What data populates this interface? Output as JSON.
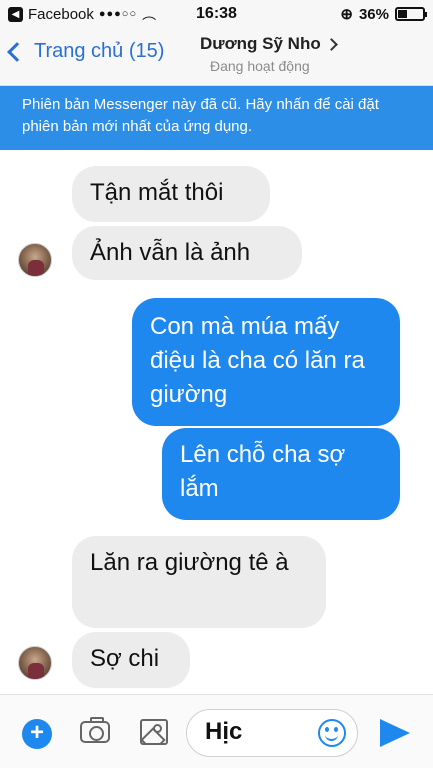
{
  "status_bar": {
    "carrier": "Facebook",
    "signal": "●●●○○",
    "time": "16:38",
    "battery_percent": "36%",
    "battery_level": 0.36
  },
  "header": {
    "back_label": "Trang chủ (15)",
    "contact_name": "Dương Sỹ Nho",
    "contact_status": "Đang hoạt động"
  },
  "banner": {
    "text": "Phiên bản Messenger này đã cũ. Hãy nhấn để cài đặt phiên bản mới nhất của ứng dụng."
  },
  "messages": [
    {
      "direction": "in",
      "text": "Tận mắt thôi"
    },
    {
      "direction": "in",
      "text": "Ảnh vẫn là ảnh"
    },
    {
      "direction": "out",
      "text": "Con mà múa mấy điệu là cha có lăn ra giường"
    },
    {
      "direction": "out",
      "text": "Lên chỗ cha sợ lắm"
    },
    {
      "direction": "in",
      "text": "Lăn ra giường tê à"
    },
    {
      "direction": "in",
      "text": "Sợ chi"
    }
  ],
  "composer": {
    "input_value": "Hịc"
  },
  "icons": {
    "add": "plus-icon",
    "camera": "camera-icon",
    "gallery": "gallery-icon",
    "emoji": "emoji-icon",
    "send": "send-icon"
  },
  "colors": {
    "accent": "#1e88ee",
    "banner": "#2d8ee8",
    "incoming_bubble": "#ececec"
  }
}
